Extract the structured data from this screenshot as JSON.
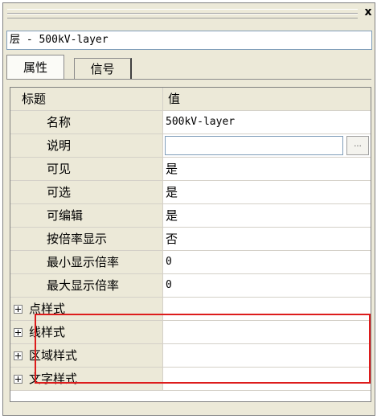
{
  "window": {
    "close_label": "x"
  },
  "layer_field": {
    "value": "层 - 500kV-layer"
  },
  "tabs": [
    {
      "label": "属性",
      "active": true
    },
    {
      "label": "信号",
      "active": false
    }
  ],
  "grid": {
    "header": {
      "name": "标题",
      "value": "值"
    },
    "properties": [
      {
        "name": "名称",
        "value": "500kV-layer"
      },
      {
        "name": "说明",
        "value": ""
      },
      {
        "name": "可见",
        "value": "是"
      },
      {
        "name": "可选",
        "value": "是"
      },
      {
        "name": "可编辑",
        "value": "是"
      },
      {
        "name": "按倍率显示",
        "value": "否"
      },
      {
        "name": "最小显示倍率",
        "value": "0"
      },
      {
        "name": "最大显示倍率",
        "value": "0"
      }
    ],
    "groups": [
      {
        "name": "点样式"
      },
      {
        "name": "线样式"
      },
      {
        "name": "区域样式"
      },
      {
        "name": "文字样式"
      }
    ],
    "ellipsis_label": "..."
  },
  "colors": {
    "highlight": "#dd1c1c",
    "panel": "#ece9d8"
  }
}
